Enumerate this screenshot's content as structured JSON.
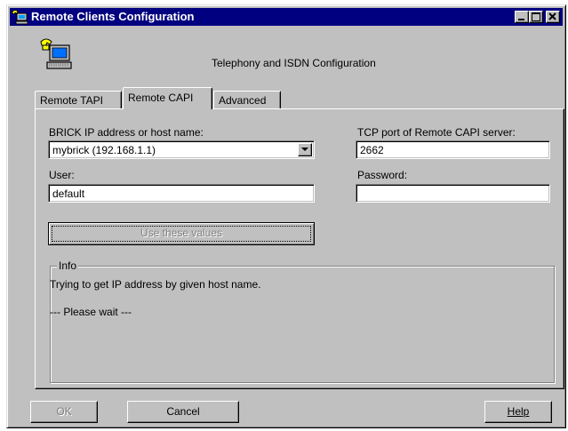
{
  "window": {
    "title": "Remote Clients Configuration",
    "title_icon": "telephone-computer-icon"
  },
  "header": {
    "title": "Telephony and ISDN Configuration",
    "icon": "telephone-computer-icon"
  },
  "tabs": [
    {
      "label": "Remote TAPI",
      "active": false
    },
    {
      "label": "Remote CAPI",
      "active": true
    },
    {
      "label": "Advanced",
      "active": false
    }
  ],
  "form": {
    "brick_label": "BRICK IP address or host name:",
    "brick_value": "mybrick (192.168.1.1)",
    "tcp_label": "TCP port of Remote CAPI server:",
    "tcp_value": "2662",
    "user_label": "User:",
    "user_value": "default",
    "password_label": "Password:",
    "password_value": "",
    "use_values_button": "Use these values"
  },
  "info": {
    "title": "Info",
    "line1": "Trying to get IP address by given host name.",
    "line2": "--- Please wait ---"
  },
  "buttons": {
    "ok": "OK",
    "cancel": "Cancel",
    "help": "Help"
  },
  "colors": {
    "face": "#c0c0c0",
    "titlebar": "#000080",
    "disabled_text": "#808080"
  }
}
